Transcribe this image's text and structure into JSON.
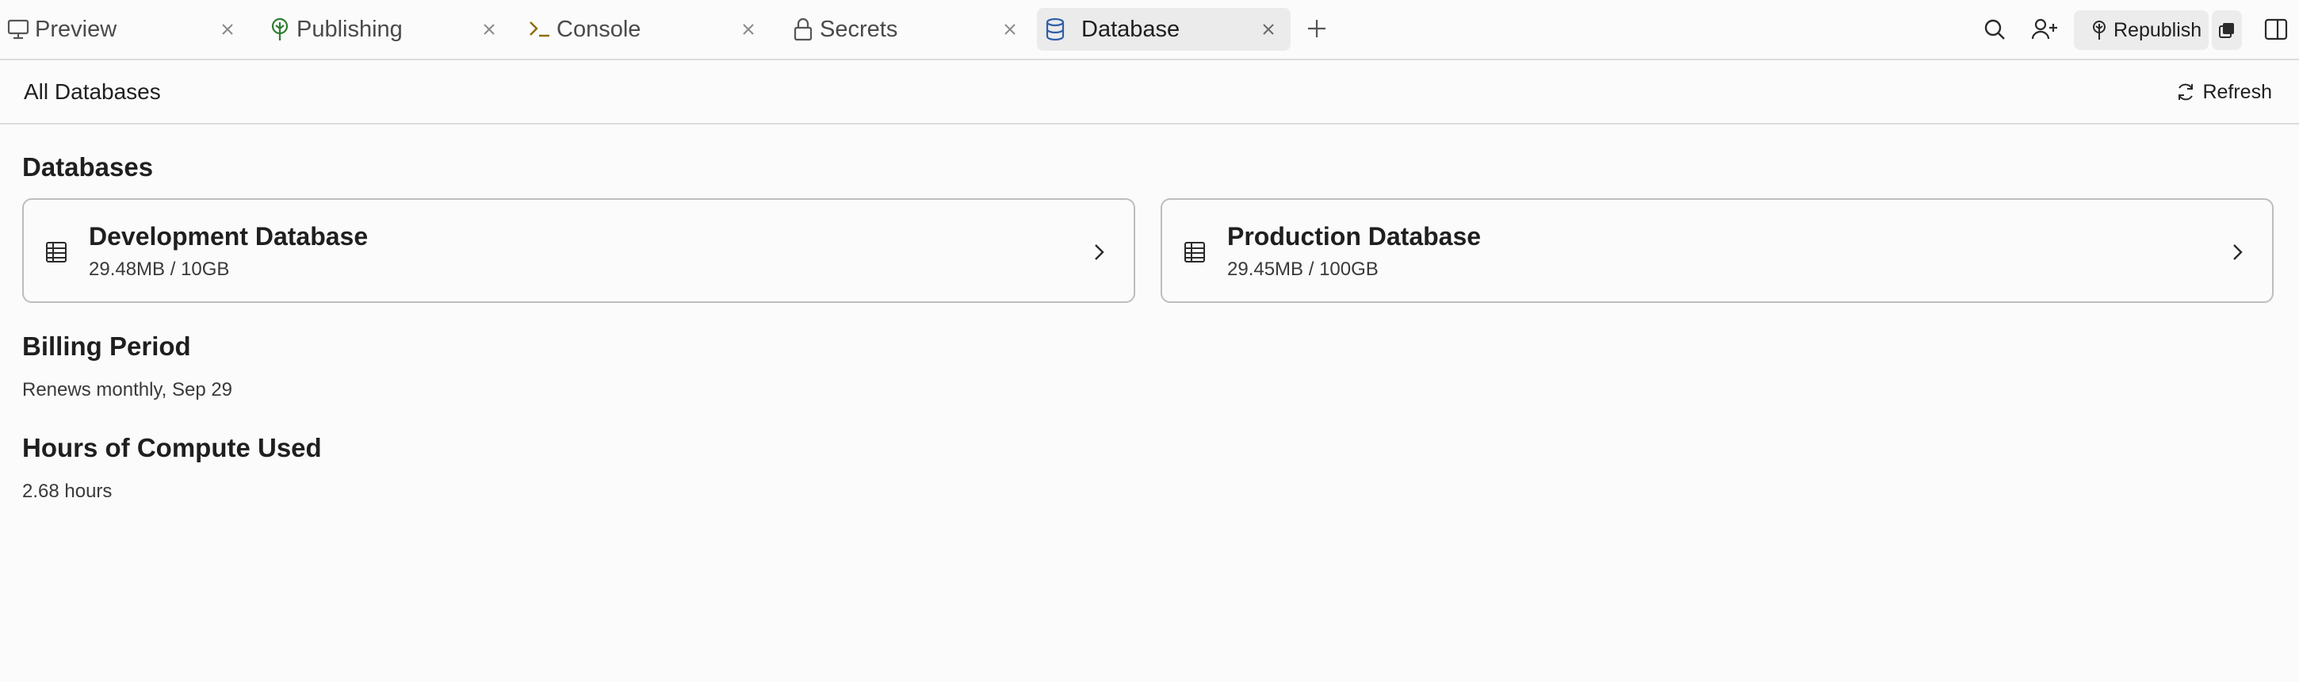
{
  "tabs": [
    {
      "label": "Preview",
      "icon": "monitor-icon",
      "active": false
    },
    {
      "label": "Publishing",
      "icon": "publishing-tree-icon",
      "active": false
    },
    {
      "label": "Console",
      "icon": "terminal-icon",
      "active": false
    },
    {
      "label": "Secrets",
      "icon": "lock-icon",
      "active": false
    },
    {
      "label": "Database",
      "icon": "database-icon",
      "active": true
    }
  ],
  "toolbar": {
    "republish_label": "Republish",
    "icons": [
      "search-icon",
      "add-user-icon",
      "republish-menu-icon",
      "split-panel-icon"
    ]
  },
  "header": {
    "title": "All Databases",
    "refresh_label": "Refresh"
  },
  "databases_section": {
    "title": "Databases",
    "cards": [
      {
        "name": "Development Database",
        "usage": "29.48MB / 10GB"
      },
      {
        "name": "Production Database",
        "usage": "29.45MB / 100GB"
      }
    ]
  },
  "billing": {
    "title": "Billing Period",
    "value": "Renews monthly, Sep 29"
  },
  "compute": {
    "title": "Hours of Compute Used",
    "value": "2.68 hours"
  },
  "colors": {
    "background": "#fbfbfb",
    "active_tab": "#ebebeb",
    "border": "#bdbdbd",
    "publishing_icon": "#2e7d32",
    "console_icon": "#8a6d00",
    "database_icon": "#2f5fa8"
  }
}
